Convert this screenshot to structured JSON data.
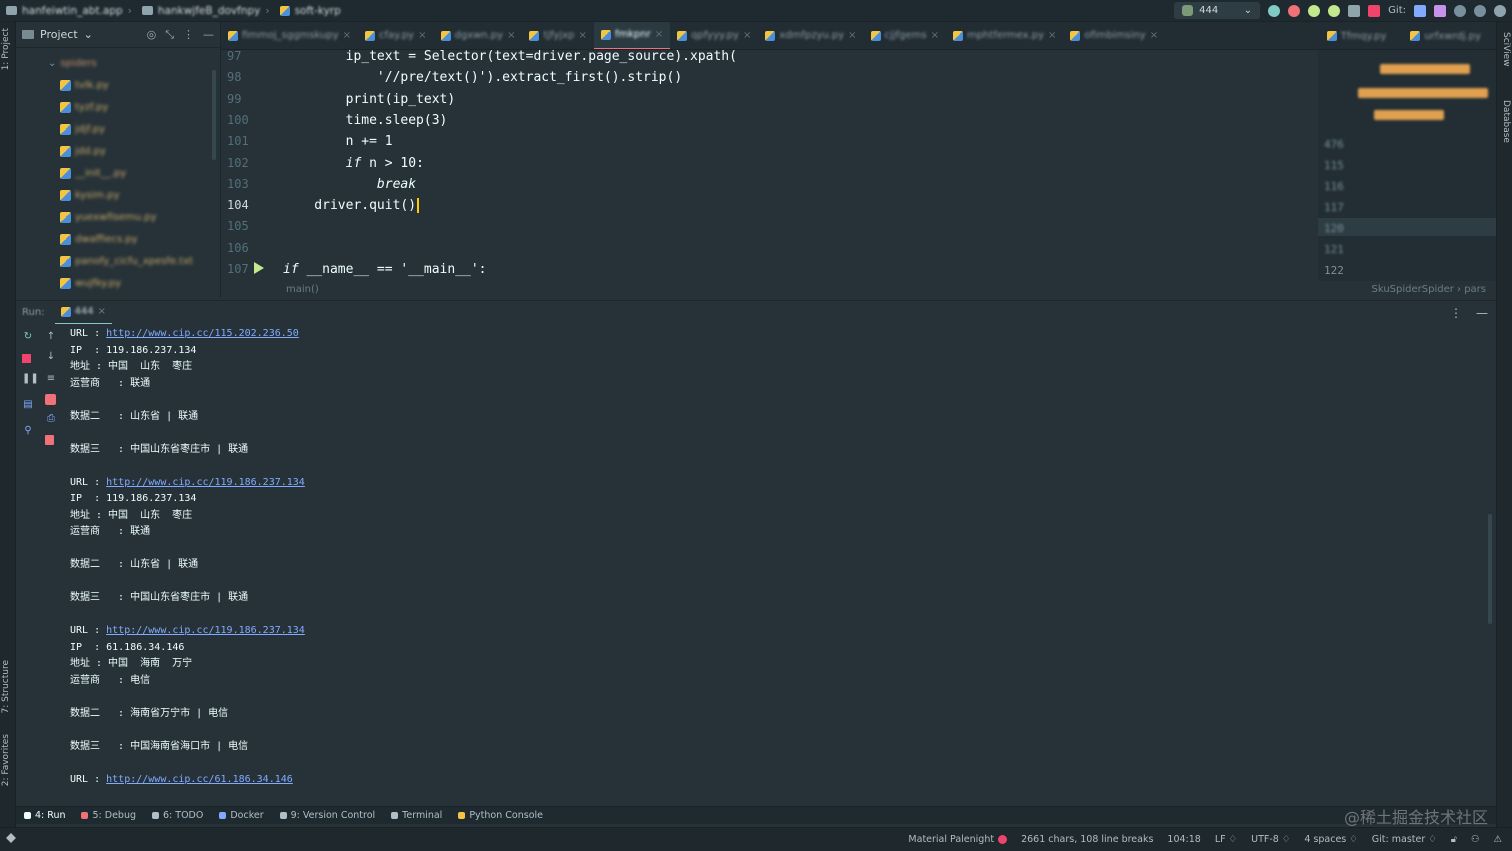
{
  "titlebar": {
    "crumbs": [
      "hanfeiwtin_abt.app",
      "hankwjfeB_dovfnpy",
      "soft-kyrp"
    ],
    "run_config": "444",
    "git_label": "Git:"
  },
  "left_strip": {
    "project_label": "1: Project",
    "structure_label": "7: Structure",
    "favorites_label": "2: Favorites"
  },
  "right_strip": {
    "sciview_label": "SciView",
    "database_label": "Database"
  },
  "project_pane": {
    "title": "Project",
    "root": "spiders",
    "files": [
      "tvlk.py",
      "tyzf.py",
      "jdjf.py",
      "jdd.py",
      "__init__.py",
      "kysim.py",
      "yuexwfisemu.py",
      "dwaffiecs.py",
      "panofy_cicfu_xpesfe.txt",
      "wujfky.py"
    ]
  },
  "tabs": {
    "items": [
      "fimmoj_sggmskupy",
      "cfay.py",
      "dgxwn.py",
      "tjfyjxp",
      "fmkpnr",
      "qpfyyy.py",
      "xdmfpzyu.py",
      "cjjfgems",
      "mphtfermex.py",
      "ofimbimsiny"
    ],
    "active_index": 4,
    "right_items": [
      "Tfmqy.py",
      "urfxwrdj.py"
    ]
  },
  "editor": {
    "lines": [
      {
        "num": "97",
        "text": "        ip_text = Selector(text=driver.page_source).xpath("
      },
      {
        "num": "98",
        "text": "            '//pre/text()').extract_first().strip()"
      },
      {
        "num": "99",
        "text": "        print(ip_text)"
      },
      {
        "num": "100",
        "text": "        time.sleep(3)"
      },
      {
        "num": "101",
        "text": "        n += 1"
      },
      {
        "num": "102",
        "kw": "if",
        "text": " n > 10:",
        "indent": "        "
      },
      {
        "num": "103",
        "kw": "break",
        "text": "",
        "indent": "            "
      },
      {
        "num": "104",
        "text": "    driver.quit()"
      },
      {
        "num": "105",
        "text": ""
      },
      {
        "num": "106",
        "text": ""
      },
      {
        "num": "107",
        "kw": "if",
        "text": " __name__ == '__main__':",
        "indent": ""
      }
    ],
    "current_line": "104",
    "breadcrumb_left": "main()",
    "breadcrumb_right": "SkuSpiderSpider  ›  pars",
    "minimap_numbers": [
      "476",
      "115",
      "116",
      "117",
      "120",
      "121",
      "122"
    ]
  },
  "run_panel": {
    "header_label": "Run:",
    "run_tab": "444",
    "console": [
      {
        "type": "url",
        "label": "URL :",
        "link": "http://www.cip.cc/115.202.236.50"
      },
      {
        "type": "text",
        "text": "IP  : 119.186.237.134"
      },
      {
        "type": "text",
        "text": "地址 : 中国  山东  枣庄"
      },
      {
        "type": "text",
        "text": "运营商   : 联通"
      },
      {
        "type": "blank"
      },
      {
        "type": "text",
        "text": "数据二   : 山东省 | 联通"
      },
      {
        "type": "blank"
      },
      {
        "type": "text",
        "text": "数据三   : 中国山东省枣庄市 | 联通"
      },
      {
        "type": "blank"
      },
      {
        "type": "url",
        "label": "URL :",
        "link": "http://www.cip.cc/119.186.237.134"
      },
      {
        "type": "text",
        "text": "IP  : 119.186.237.134"
      },
      {
        "type": "text",
        "text": "地址 : 中国  山东  枣庄"
      },
      {
        "type": "text",
        "text": "运营商   : 联通"
      },
      {
        "type": "blank"
      },
      {
        "type": "text",
        "text": "数据二   : 山东省 | 联通"
      },
      {
        "type": "blank"
      },
      {
        "type": "text",
        "text": "数据三   : 中国山东省枣庄市 | 联通"
      },
      {
        "type": "blank"
      },
      {
        "type": "url",
        "label": "URL :",
        "link": "http://www.cip.cc/119.186.237.134"
      },
      {
        "type": "text",
        "text": "IP  : 61.186.34.146"
      },
      {
        "type": "text",
        "text": "地址 : 中国  海南  万宁"
      },
      {
        "type": "text",
        "text": "运营商   : 电信"
      },
      {
        "type": "blank"
      },
      {
        "type": "text",
        "text": "数据二   : 海南省万宁市 | 电信"
      },
      {
        "type": "blank"
      },
      {
        "type": "text",
        "text": "数据三   : 中国海南省海口市 | 电信"
      },
      {
        "type": "blank"
      },
      {
        "type": "url",
        "label": "URL :",
        "link": "http://www.cip.cc/61.186.34.146"
      }
    ]
  },
  "bottom_tools": [
    {
      "icon": "play-icon",
      "label": "4: Run",
      "active": true,
      "color": "#eeffff"
    },
    {
      "icon": "bug-icon",
      "label": "5: Debug",
      "active": false,
      "color": "#f07178"
    },
    {
      "icon": "todo-icon",
      "label": "6: TODO",
      "active": false,
      "color": "#b0bec5"
    },
    {
      "icon": "docker-icon",
      "label": "Docker",
      "active": false,
      "color": "#82aaff"
    },
    {
      "icon": "vcs-icon",
      "label": "9: Version Control",
      "active": false,
      "color": "#b0bec5"
    },
    {
      "icon": "terminal-icon",
      "label": "Terminal",
      "active": false,
      "color": "#b0bec5"
    },
    {
      "icon": "python-console-icon",
      "label": "Python Console",
      "active": false,
      "color": "#f4c542"
    }
  ],
  "watermark": "@稀土掘金技术社区",
  "status": {
    "theme": "Material Palenight",
    "chars": "2661 chars, 108 line breaks",
    "position": "104:18",
    "line_sep": "LF ♢",
    "encoding": "UTF-8 ♢",
    "indent": "4 spaces ♢",
    "git": "Git: master ♢"
  },
  "colors": {
    "accent": "#80cbc4",
    "active_tab": "#f07178",
    "link": "#82aaff",
    "caret": "#ffcc00",
    "theme_dot": "#f0446c"
  }
}
